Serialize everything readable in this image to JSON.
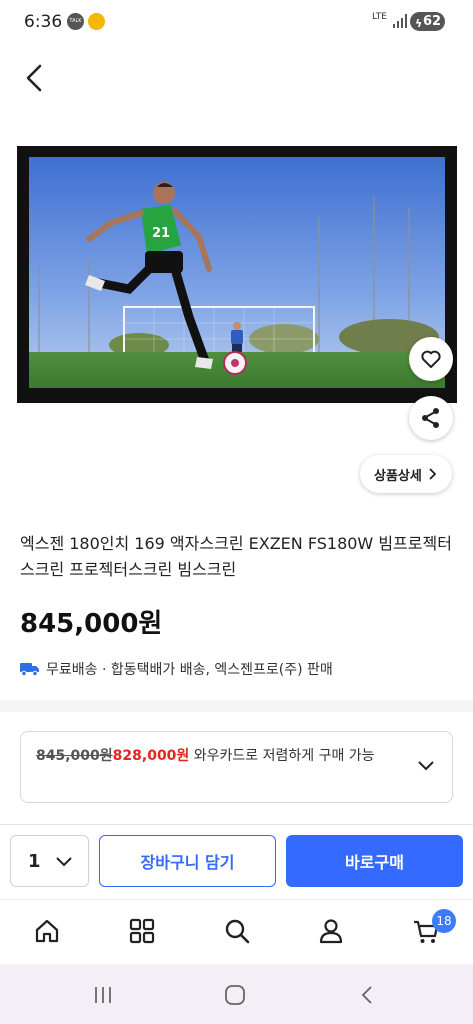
{
  "status_bar": {
    "time": "6:36",
    "talk_label": "TALK",
    "network": "LTE",
    "battery": "62"
  },
  "product": {
    "title": "엑스젠 180인치 169 액자스크린 EXZEN FS180W 빔프로젝터스크린 프로젝터스크린 빔스크린",
    "price": "845,000원",
    "detail_button_label": "상품상세",
    "shipping_text": "무료배송 · 합동택배가 배송, 엑스젠프로(주) 판매"
  },
  "card_offer": {
    "old_price": "845,000원",
    "new_price": "828,000원",
    "message": " 와우카드로 저렴하게 구매 가능"
  },
  "purchase_bar": {
    "quantity": "1",
    "cart_label": "장바구니 담기",
    "buy_label": "바로구매"
  },
  "bottom_nav": {
    "items": [
      "home-icon",
      "category-icon",
      "search-icon",
      "my-account-icon",
      "cart-icon"
    ],
    "cart_count": "18"
  },
  "colors": {
    "accent": "#346aff",
    "sale_price": "#e3261c",
    "badge": "#3d7bff"
  }
}
